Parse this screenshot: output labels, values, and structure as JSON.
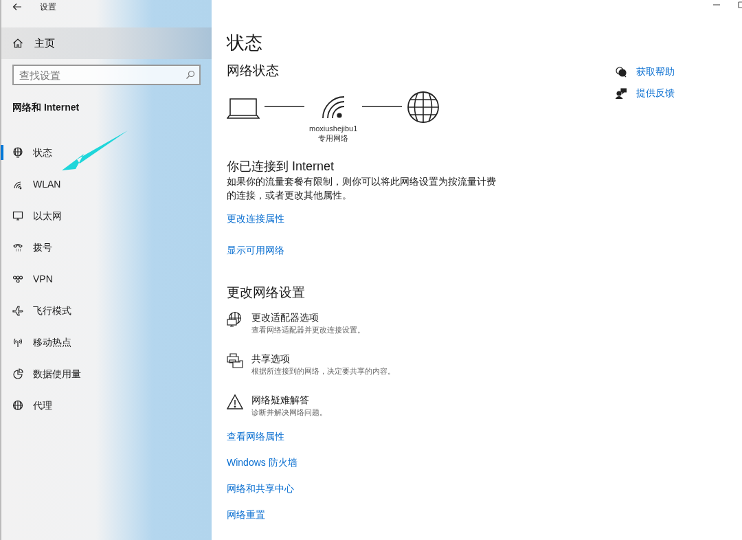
{
  "window": {
    "title": "设置"
  },
  "sidebar": {
    "home": "主页",
    "search": {
      "placeholder": "查找设置"
    },
    "section_title": "网络和 Internet",
    "items": [
      {
        "kind": "status",
        "label": "状态",
        "selected": true
      },
      {
        "kind": "wifi",
        "label": "WLAN",
        "selected": false
      },
      {
        "kind": "ethernet",
        "label": "以太网",
        "selected": false
      },
      {
        "kind": "dialup",
        "label": "拨号",
        "selected": false
      },
      {
        "kind": "vpn",
        "label": "VPN",
        "selected": false
      },
      {
        "kind": "airplane",
        "label": "飞行模式",
        "selected": false
      },
      {
        "kind": "hotspot",
        "label": "移动热点",
        "selected": false
      },
      {
        "kind": "data",
        "label": "数据使用量",
        "selected": false
      },
      {
        "kind": "proxy",
        "label": "代理",
        "selected": false
      }
    ]
  },
  "main": {
    "title": "状态",
    "network_status": {
      "heading": "网络状态",
      "network_name": "moxiushejibu1",
      "network_type": "专用网络"
    },
    "connection": {
      "title": "你已连接到 Internet",
      "description": "如果你的流量套餐有限制，则你可以将此网络设置为按流量计费的连接，或者更改其他属性。",
      "links": [
        "更改连接属性",
        "显示可用网络"
      ]
    },
    "change_settings": {
      "heading": "更改网络设置",
      "options": [
        {
          "kind": "adapter",
          "title": "更改适配器选项",
          "description": "查看网络适配器并更改连接设置。"
        },
        {
          "kind": "sharing",
          "title": "共享选项",
          "description": "根据所连接到的网络，决定要共享的内容。"
        },
        {
          "kind": "troubleshoot",
          "title": "网络疑难解答",
          "description": "诊断并解决网络问题。"
        }
      ],
      "links": [
        "查看网络属性",
        "Windows 防火墙",
        "网络和共享中心",
        "网络重置"
      ]
    }
  },
  "help": {
    "links": [
      {
        "kind": "help",
        "label": "获取帮助"
      },
      {
        "kind": "feedback",
        "label": "提供反馈"
      }
    ]
  }
}
